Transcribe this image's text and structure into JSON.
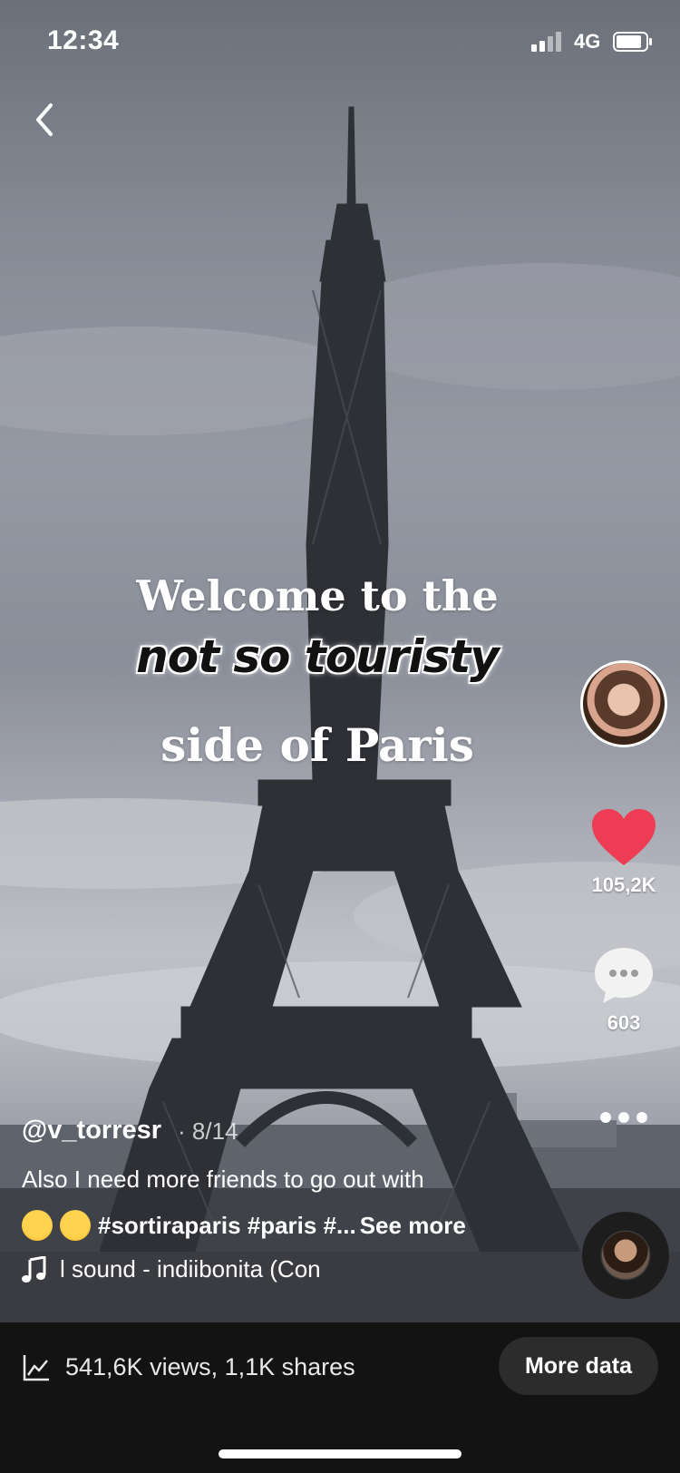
{
  "status_bar": {
    "time": "12:34",
    "network": "4G"
  },
  "overlay": {
    "line1": "Welcome to the",
    "line2": "not so touristy",
    "line3": "side of Paris"
  },
  "actions": {
    "likes": "105,2K",
    "comments": "603"
  },
  "post": {
    "username": "@v_torresr",
    "date": "· 8/14",
    "caption": "Also I need more friends to go out with",
    "tags": "#sortiraparis #paris #...",
    "see_more": "See more",
    "sound": "l sound - indiibonita (Con"
  },
  "footer": {
    "stats": "541,6K views, 1,1K shares",
    "more_data_label": "More data"
  },
  "colors": {
    "like": "#ee3c55",
    "background": "#131313"
  },
  "icons": [
    "back-icon",
    "signal-icon",
    "battery-icon",
    "heart-icon",
    "comment-icon",
    "more-icon",
    "music-note-icon",
    "stats-chart-icon"
  ]
}
